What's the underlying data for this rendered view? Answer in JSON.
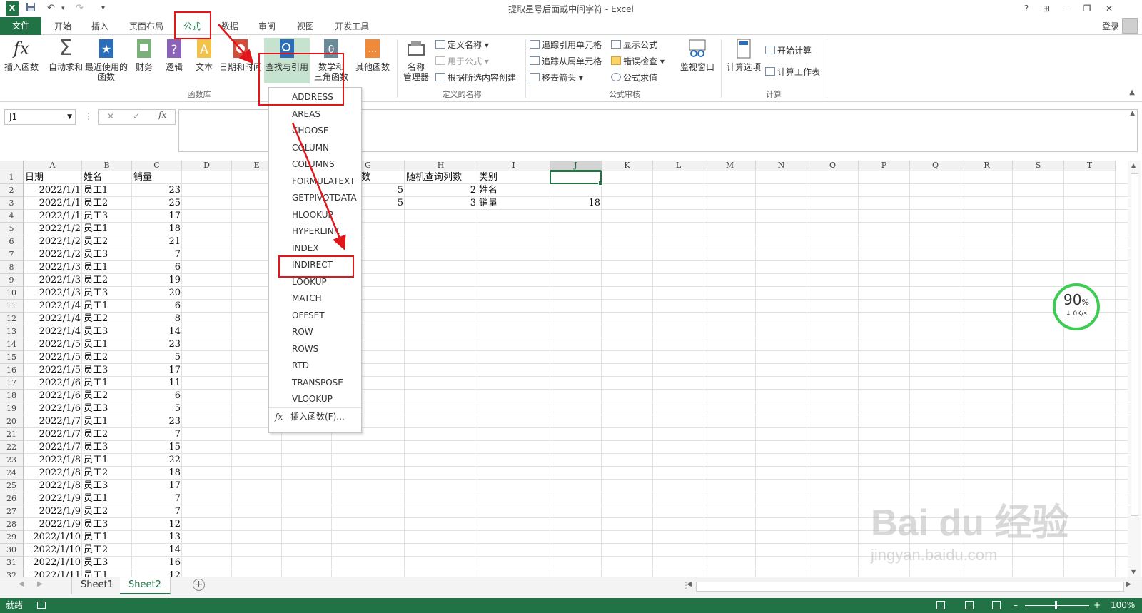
{
  "window": {
    "title": "提取星号后面或中间字符 - Excel",
    "help": "?",
    "restore_ribbon": "⊞",
    "minimize": "–",
    "maximize": "❐",
    "close": "✕"
  },
  "quick_access": {
    "undo": "↶",
    "redo": "↷",
    "customize": "▾"
  },
  "tabs": [
    {
      "label": "文件"
    },
    {
      "label": "开始"
    },
    {
      "label": "插入"
    },
    {
      "label": "页面布局"
    },
    {
      "label": "公式"
    },
    {
      "label": "数据"
    },
    {
      "label": "审阅"
    },
    {
      "label": "视图"
    },
    {
      "label": "开发工具"
    }
  ],
  "login": "登录",
  "ribbon": {
    "buttons": {
      "insert_fn": "插入函数",
      "autosum": "自动求和",
      "recent_1": "最近使用的",
      "recent_2": "函数",
      "financial": "财务",
      "logical": "逻辑",
      "text": "文本",
      "datetime": "日期和时间",
      "lookup": "查找与引用",
      "math_1": "数学和",
      "math_2": "三角函数",
      "other": "其他函数",
      "name_mgr_1": "名称",
      "name_mgr_2": "管理器",
      "watch": "监视窗口",
      "calc_opts": "计算选项"
    },
    "small": {
      "define_name": "定义名称",
      "use_in_formula": "用于公式",
      "create_from_sel": "根据所选内容创建",
      "trace_precedents": "追踪引用单元格",
      "trace_dependents": "追踪从属单元格",
      "remove_arrows": "移去箭头",
      "show_formulas": "显示公式",
      "error_check": "错误检查",
      "evaluate": "公式求值",
      "calc_now": "开始计算",
      "calc_sheet": "计算工作表"
    },
    "groups": {
      "function_library": "函数库",
      "defined_names": "定义的名称",
      "formula_auditing": "公式审核",
      "calculation": "计算"
    }
  },
  "formula_bar": {
    "name_box": "J1",
    "cancel": "✕",
    "enter": "✓",
    "fx": "fx",
    "formula": ""
  },
  "columns": [
    "A",
    "B",
    "C",
    "D",
    "E",
    "F",
    "G",
    "H",
    "I",
    "J",
    "K",
    "L",
    "M",
    "N",
    "O",
    "P",
    "Q",
    "R",
    "S",
    "T"
  ],
  "selected_column": "J",
  "rows": [
    [
      "日期",
      "姓名",
      "销量",
      "",
      "",
      "",
      "查询行数",
      "随机查询列数",
      "类别",
      ""
    ],
    [
      "2022/1/1",
      "员工1",
      "23",
      "",
      "",
      "",
      "5",
      "2",
      "姓名",
      ""
    ],
    [
      "2022/1/1",
      "员工2",
      "25",
      "",
      "",
      "",
      "5",
      "3",
      "销量",
      "18"
    ],
    [
      "2022/1/1",
      "员工3",
      "17"
    ],
    [
      "2022/1/2",
      "员工1",
      "18"
    ],
    [
      "2022/1/2",
      "员工2",
      "21"
    ],
    [
      "2022/1/2",
      "员工3",
      "7"
    ],
    [
      "2022/1/3",
      "员工1",
      "6"
    ],
    [
      "2022/1/3",
      "员工2",
      "19"
    ],
    [
      "2022/1/3",
      "员工3",
      "20"
    ],
    [
      "2022/1/4",
      "员工1",
      "6"
    ],
    [
      "2022/1/4",
      "员工2",
      "8"
    ],
    [
      "2022/1/4",
      "员工3",
      "14"
    ],
    [
      "2022/1/5",
      "员工1",
      "23"
    ],
    [
      "2022/1/5",
      "员工2",
      "5"
    ],
    [
      "2022/1/5",
      "员工3",
      "17"
    ],
    [
      "2022/1/6",
      "员工1",
      "11"
    ],
    [
      "2022/1/6",
      "员工2",
      "6"
    ],
    [
      "2022/1/6",
      "员工3",
      "5"
    ],
    [
      "2022/1/7",
      "员工1",
      "23"
    ],
    [
      "2022/1/7",
      "员工2",
      "7"
    ],
    [
      "2022/1/7",
      "员工3",
      "15"
    ],
    [
      "2022/1/8",
      "员工1",
      "22"
    ],
    [
      "2022/1/8",
      "员工2",
      "18"
    ],
    [
      "2022/1/8",
      "员工3",
      "17"
    ],
    [
      "2022/1/9",
      "员工1",
      "7"
    ],
    [
      "2022/1/9",
      "员工2",
      "7"
    ],
    [
      "2022/1/9",
      "员工3",
      "12"
    ],
    [
      "2022/1/10",
      "员工1",
      "13"
    ],
    [
      "2022/1/10",
      "员工2",
      "14"
    ],
    [
      "2022/1/10",
      "员工3",
      "16"
    ],
    [
      "2022/1/11",
      "员工1",
      "12"
    ]
  ],
  "dropdown": {
    "items": [
      "ADDRESS",
      "AREAS",
      "CHOOSE",
      "COLUMN",
      "COLUMNS",
      "FORMULATEXT",
      "GETPIVOTDATA",
      "HLOOKUP",
      "HYPERLINK",
      "INDEX",
      "INDIRECT",
      "LOOKUP",
      "MATCH",
      "OFFSET",
      "ROW",
      "ROWS",
      "RTD",
      "TRANSPOSE",
      "VLOOKUP"
    ],
    "insert_function": "插入函数(F)...",
    "fx_icon": "fx"
  },
  "sheets": [
    {
      "label": "Sheet1"
    },
    {
      "label": "Sheet2"
    }
  ],
  "active_sheet": "Sheet2",
  "status": {
    "ready": "就绪",
    "zoom": "100%"
  },
  "speed_widget": {
    "percent": "90",
    "unit": "%",
    "rate": "↓ 0K/s"
  },
  "watermark": {
    "main": "Bai du 经验",
    "url": "jingyan.baidu.com"
  },
  "colors": {
    "excel_green": "#217346",
    "annotation_red": "#e0161b",
    "gauge_green": "#3ccc52",
    "lookup_btn": "#c6e3d0"
  }
}
